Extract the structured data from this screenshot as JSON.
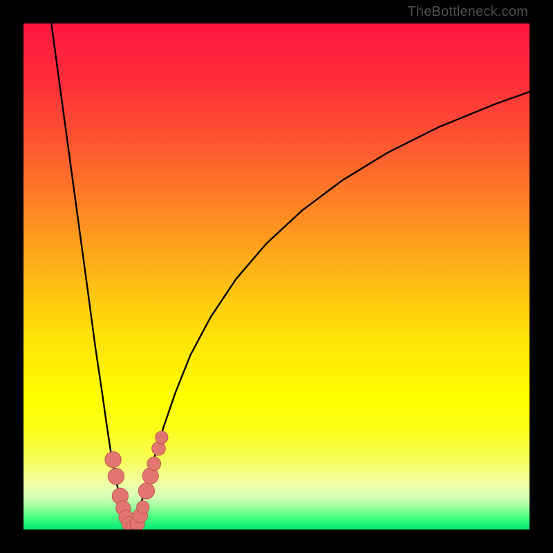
{
  "watermark": "TheBottleneck.com",
  "colors": {
    "frame": "#000000",
    "curve": "#000000",
    "marker_fill": "#e0766f",
    "marker_stroke": "#b84f48",
    "gradient_stops": [
      {
        "offset": 0.0,
        "color": "#fe1740"
      },
      {
        "offset": 0.12,
        "color": "#fe2f3b"
      },
      {
        "offset": 0.25,
        "color": "#fe5b30"
      },
      {
        "offset": 0.38,
        "color": "#fe8b23"
      },
      {
        "offset": 0.5,
        "color": "#feb915"
      },
      {
        "offset": 0.62,
        "color": "#fee209"
      },
      {
        "offset": 0.74,
        "color": "#feff00"
      },
      {
        "offset": 0.8,
        "color": "#fbff18"
      },
      {
        "offset": 0.86,
        "color": "#f6ff55"
      },
      {
        "offset": 0.905,
        "color": "#f3ffa0"
      },
      {
        "offset": 0.935,
        "color": "#d7ffb8"
      },
      {
        "offset": 0.955,
        "color": "#9dffa0"
      },
      {
        "offset": 0.975,
        "color": "#4cff80"
      },
      {
        "offset": 1.0,
        "color": "#00e874"
      }
    ]
  },
  "chart_data": {
    "type": "line",
    "title": "",
    "xlabel": "",
    "ylabel": "",
    "xlim": [
      0,
      100
    ],
    "ylim": [
      0,
      100
    ],
    "grid": false,
    "series": [
      {
        "name": "left-branch",
        "x": [
          5.5,
          7,
          8.5,
          10,
          11.5,
          13,
          14.2,
          15.4,
          16.4,
          17.3,
          18.1,
          18.9,
          19.6,
          20.2,
          20.9,
          21.5
        ],
        "y": [
          100,
          89,
          78,
          67,
          56,
          45,
          36,
          28,
          21,
          15,
          10.5,
          7,
          4.5,
          2.8,
          1.4,
          0.3
        ]
      },
      {
        "name": "right-branch",
        "x": [
          21.5,
          22.3,
          23.2,
          24.4,
          25.8,
          27.6,
          30,
          33,
          37,
          42,
          48,
          55,
          63,
          72,
          82,
          93,
          100
        ],
        "y": [
          0.3,
          2,
          5,
          9,
          14,
          20,
          27,
          34.5,
          42,
          49.5,
          56.5,
          63,
          69,
          74.5,
          79.5,
          84,
          86.5
        ]
      }
    ],
    "markers": [
      {
        "x": 17.7,
        "y": 13.8,
        "r": 1.6
      },
      {
        "x": 18.3,
        "y": 10.5,
        "r": 1.6
      },
      {
        "x": 19.1,
        "y": 6.6,
        "r": 1.6
      },
      {
        "x": 19.7,
        "y": 4.2,
        "r": 1.45
      },
      {
        "x": 20.3,
        "y": 2.4,
        "r": 1.45
      },
      {
        "x": 20.9,
        "y": 1.1,
        "r": 1.45
      },
      {
        "x": 21.7,
        "y": 0.4,
        "r": 1.45
      },
      {
        "x": 22.5,
        "y": 1.2,
        "r": 1.45
      },
      {
        "x": 23.1,
        "y": 2.8,
        "r": 1.45
      },
      {
        "x": 23.6,
        "y": 4.4,
        "r": 1.25
      },
      {
        "x": 24.3,
        "y": 7.6,
        "r": 1.6
      },
      {
        "x": 25.1,
        "y": 10.6,
        "r": 1.6
      },
      {
        "x": 25.8,
        "y": 13.0,
        "r": 1.35
      },
      {
        "x": 26.7,
        "y": 16.0,
        "r": 1.35
      },
      {
        "x": 27.3,
        "y": 18.2,
        "r": 1.25
      }
    ]
  }
}
